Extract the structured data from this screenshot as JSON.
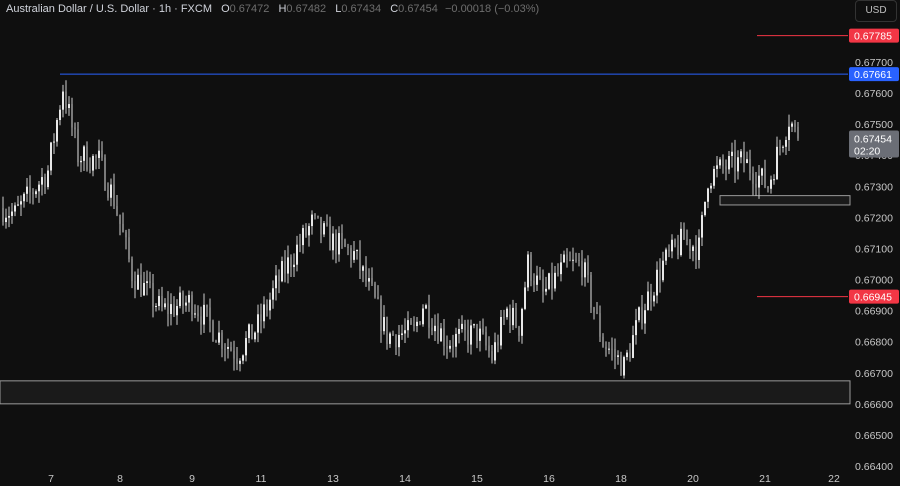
{
  "header": {
    "title": "Australian Dollar / U.S. Dollar · 1h · FXCM",
    "o_label": "O",
    "o": "0.67472",
    "h_label": "H",
    "h": "0.67482",
    "l_label": "L",
    "l": "0.67434",
    "c_label": "C",
    "c": "0.67454",
    "change": "−0.00018 (−0.03%)"
  },
  "currency_button": "USD",
  "chart_data": {
    "type": "candlestick",
    "title": "Australian Dollar / U.S. Dollar · 1h · FXCM",
    "ylim": [
      0.6639,
      0.6792
    ],
    "y_ticks": [
      "0.67700",
      "0.67600",
      "0.67500",
      "0.67400",
      "0.67300",
      "0.67200",
      "0.67100",
      "0.67000",
      "0.66900",
      "0.66800",
      "0.66700",
      "0.66600",
      "0.66500",
      "0.66400"
    ],
    "x_ticks": [
      {
        "label": "7",
        "idx": 16
      },
      {
        "label": "8",
        "idx": 39
      },
      {
        "label": "9",
        "idx": 63
      },
      {
        "label": "11",
        "idx": 86
      },
      {
        "label": "13",
        "idx": 110
      },
      {
        "label": "14",
        "idx": 134
      },
      {
        "label": "15",
        "idx": 158
      },
      {
        "label": "16",
        "idx": 182
      },
      {
        "label": "18",
        "idx": 206
      },
      {
        "label": "20",
        "idx": 230
      },
      {
        "label": "21",
        "idx": 254
      },
      {
        "label": "22",
        "idx": 277
      }
    ],
    "price_path": [
      [
        0,
        0.6723
      ],
      [
        4,
        0.6721
      ],
      [
        15,
        0.6735
      ],
      [
        20,
        0.6762
      ],
      [
        25,
        0.674
      ],
      [
        32,
        0.6738
      ],
      [
        37,
        0.6726
      ],
      [
        43,
        0.6702
      ],
      [
        53,
        0.669
      ],
      [
        63,
        0.6693
      ],
      [
        72,
        0.6682
      ],
      [
        78,
        0.6676
      ],
      [
        85,
        0.6685
      ],
      [
        92,
        0.67
      ],
      [
        98,
        0.671
      ],
      [
        103,
        0.6718
      ],
      [
        110,
        0.6712
      ],
      [
        117,
        0.6708
      ],
      [
        123,
        0.6695
      ],
      [
        128,
        0.6682
      ],
      [
        137,
        0.6683
      ],
      [
        140,
        0.6692
      ],
      [
        148,
        0.668
      ],
      [
        158,
        0.6683
      ],
      [
        163,
        0.6675
      ],
      [
        168,
        0.669
      ],
      [
        172,
        0.6685
      ],
      [
        175,
        0.6705
      ],
      [
        180,
        0.6695
      ],
      [
        187,
        0.6704
      ],
      [
        193,
        0.6705
      ],
      [
        197,
        0.669
      ],
      [
        200,
        0.668
      ],
      [
        207,
        0.6672
      ],
      [
        213,
        0.669
      ],
      [
        220,
        0.6705
      ],
      [
        227,
        0.6713
      ],
      [
        232,
        0.671
      ],
      [
        235,
        0.6733
      ],
      [
        240,
        0.6736
      ],
      [
        247,
        0.6738
      ],
      [
        255,
        0.673
      ],
      [
        258,
        0.674
      ],
      [
        262,
        0.6752
      ],
      [
        265,
        0.6745
      ]
    ],
    "levels": [
      {
        "name": "resistance-red-top",
        "price": 0.67785,
        "label": "0.67785",
        "color": "#f23645"
      },
      {
        "name": "resistance-blue",
        "price": 0.67661,
        "label": "0.67661",
        "color": "#2962ff"
      },
      {
        "name": "support-red",
        "price": 0.66945,
        "label": "0.66945",
        "color": "#f23645"
      }
    ],
    "zones": [
      {
        "name": "support-zone-low",
        "from": 0.666,
        "to": 0.66674
      },
      {
        "name": "support-zone-mid",
        "from": 0.6724,
        "to": 0.6727
      }
    ],
    "last_price": {
      "label": "0.67454",
      "countdown": "02:20",
      "color": "#6b6e76"
    }
  }
}
